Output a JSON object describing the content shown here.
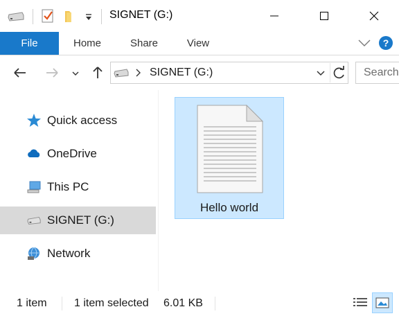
{
  "window": {
    "title": "SIGNET (G:)"
  },
  "ribbon": {
    "tabs": [
      {
        "label": "File"
      },
      {
        "label": "Share"
      },
      {
        "label": "View"
      }
    ],
    "home_label": "Home"
  },
  "address": {
    "location": "SIGNET (G:)",
    "search_placeholder": "Search"
  },
  "nav": {
    "items": [
      {
        "label": "Quick access"
      },
      {
        "label": "OneDrive"
      },
      {
        "label": "This PC"
      },
      {
        "label": "SIGNET (G:)"
      },
      {
        "label": "Network"
      }
    ]
  },
  "files": [
    {
      "name": "Hello world"
    }
  ],
  "status": {
    "count": "1 item",
    "selected": "1 item selected",
    "size": "6.01 KB"
  },
  "colors": {
    "accent": "#1979ca",
    "selection_bg": "#cce8ff",
    "selection_border": "#99d1ff",
    "nav_selected": "#d9d9d9"
  }
}
